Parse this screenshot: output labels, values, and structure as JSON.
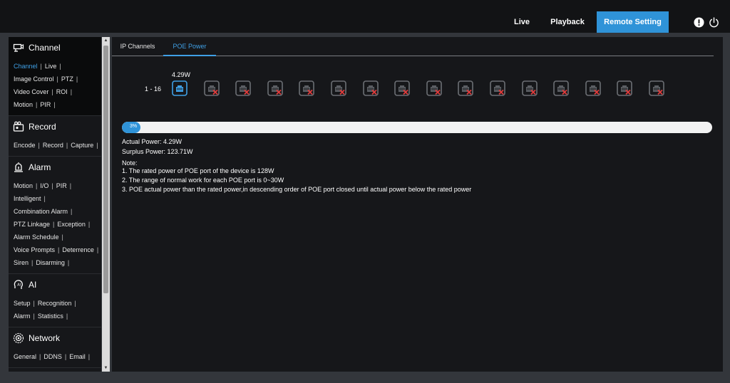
{
  "topnav": {
    "live": "Live",
    "playback": "Playback",
    "remote_setting": "Remote Setting"
  },
  "colors": {
    "accent": "#2f93d8",
    "link_active": "#3fa0e6",
    "port_off_x": "#e23b3b"
  },
  "sidebar": {
    "channel": {
      "title": "Channel",
      "icon": "camera-icon",
      "rows": [
        [
          "Channel",
          "Live"
        ],
        [
          "Image Control",
          "PTZ"
        ],
        [
          "Video Cover",
          "ROI"
        ],
        [
          "Motion",
          "PIR"
        ]
      ]
    },
    "record": {
      "title": "Record",
      "icon": "record-icon",
      "rows": [
        [
          "Encode",
          "Record",
          "Capture"
        ]
      ]
    },
    "alarm": {
      "title": "Alarm",
      "icon": "alarm-icon",
      "rows": [
        [
          "Motion",
          "I/O",
          "PIR"
        ],
        [
          "Intelligent"
        ],
        [
          "Combination Alarm"
        ],
        [
          "PTZ Linkage",
          "Exception"
        ],
        [
          "Alarm Schedule"
        ],
        [
          "Voice Prompts",
          "Deterrence"
        ],
        [
          "Siren",
          "Disarming"
        ]
      ]
    },
    "ai": {
      "title": "AI",
      "icon": "ai-icon",
      "rows": [
        [
          "Setup",
          "Recognition"
        ],
        [
          "Alarm",
          "Statistics"
        ]
      ]
    },
    "network": {
      "title": "Network",
      "icon": "network-icon",
      "rows": [
        [
          "General",
          "DDNS",
          "Email"
        ]
      ]
    }
  },
  "tabs": {
    "ip_channels": "IP Channels",
    "poe_power": "POE Power"
  },
  "poe": {
    "port_power_label": "4.29W",
    "range": "1 - 16",
    "ports_active": [
      true,
      false,
      false,
      false,
      false,
      false,
      false,
      false,
      false,
      false,
      false,
      false,
      false,
      false,
      false,
      false
    ],
    "usage_percent": 3,
    "usage_text": "3%",
    "actual_power": "Actual Power: 4.29W",
    "surplus_power": "Surplus Power: 123.71W",
    "note_title": "Note:",
    "notes": [
      "1. The rated power of POE port of the device is 128W",
      "2. The range of normal work for each POE port is 0~30W",
      "3. POE actual power than the rated power,in descending order of POE port closed until actual power below the rated power"
    ]
  }
}
